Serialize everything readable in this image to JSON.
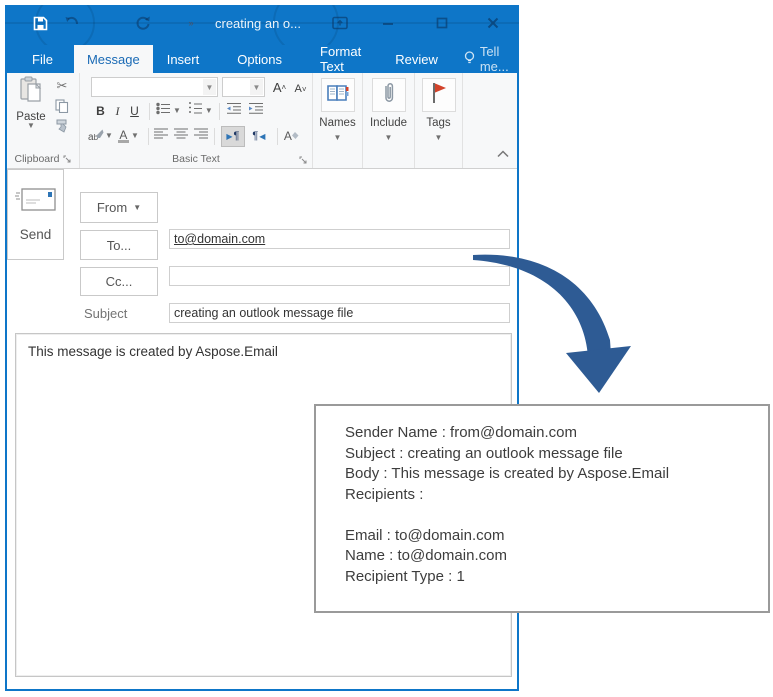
{
  "titlebar": {
    "title": "creating an o..."
  },
  "tabs": {
    "items": [
      "File",
      "Message",
      "Insert",
      "Options",
      "Format Text",
      "Review"
    ],
    "selected": "Message",
    "tell_me": "Tell me..."
  },
  "ribbon": {
    "paste": "Paste",
    "bold": "B",
    "italic": "I",
    "underline": "U",
    "names": "Names",
    "include": "Include",
    "tags": "Tags",
    "clipboard_group": "Clipboard",
    "basic_text_group": "Basic Text"
  },
  "compose": {
    "send": "Send",
    "from": "From",
    "to": "To...",
    "cc": "Cc...",
    "subject_label": "Subject",
    "to_value": "to@domain.com",
    "cc_value": "",
    "subject_value": "creating an outlook message file",
    "body": "This message is created by Aspose.Email"
  },
  "output": {
    "lines": [
      "Sender Name : from@domain.com",
      "Subject : creating an outlook message file",
      "Body : This message is created by Aspose.Email",
      "Recipients :",
      "",
      "Email : to@domain.com",
      "Name : to@domain.com",
      "Recipient Type : 1"
    ]
  },
  "colors": {
    "titlebar_blue": "#0E76C8",
    "arrow_blue": "#2E5B94",
    "flag_red": "#D2432B"
  }
}
